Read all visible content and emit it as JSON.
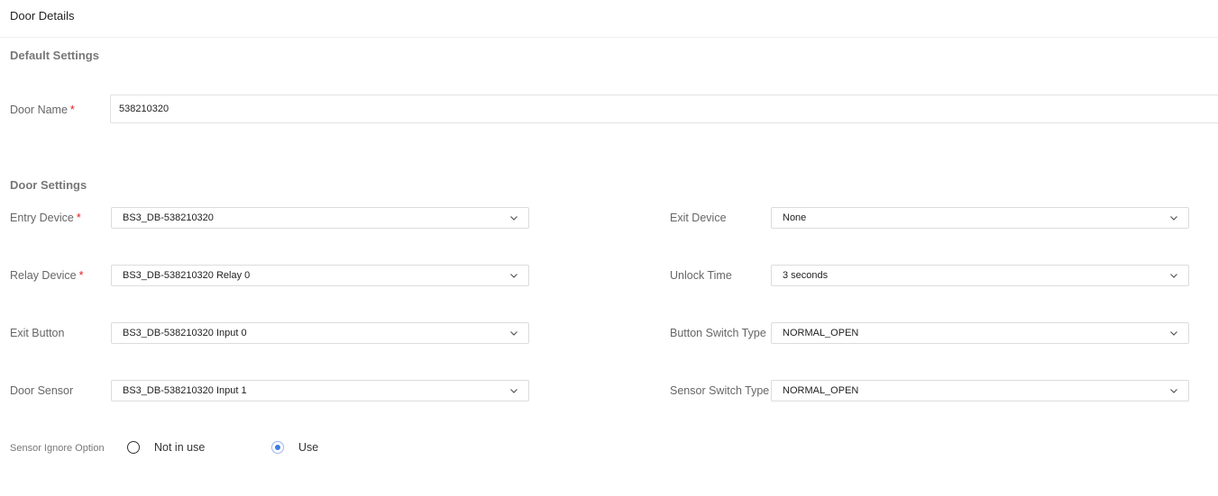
{
  "page": {
    "title": "Door Details"
  },
  "default_settings": {
    "section_title": "Default Settings",
    "door_name": {
      "label": "Door Name",
      "required_mark": "*",
      "value": "538210320"
    }
  },
  "door_settings": {
    "section_title": "Door Settings",
    "entry_device": {
      "label": "Entry Device",
      "required_mark": "*",
      "value": "BS3_DB-538210320"
    },
    "exit_device": {
      "label": "Exit Device",
      "value": "None"
    },
    "relay_device": {
      "label": "Relay Device",
      "required_mark": "*",
      "value": "BS3_DB-538210320 Relay 0"
    },
    "unlock_time": {
      "label": "Unlock Time",
      "value": "3 seconds"
    },
    "exit_button": {
      "label": "Exit Button",
      "value": "BS3_DB-538210320 Input 0"
    },
    "button_switch_type": {
      "label": "Button Switch Type",
      "value": "NORMAL_OPEN"
    },
    "door_sensor": {
      "label": "Door Sensor",
      "value": "BS3_DB-538210320 Input 1"
    },
    "sensor_switch_type": {
      "label": "Sensor Switch Type",
      "value": "NORMAL_OPEN"
    },
    "sensor_ignore_option": {
      "label": "Sensor Ignore Option",
      "options": [
        {
          "label": "Not in use",
          "selected": false
        },
        {
          "label": "Use",
          "selected": true
        }
      ]
    }
  },
  "icons": {
    "dropdown": "chevron-down-icon",
    "radio": "radio-button-icon"
  },
  "colors": {
    "required": "#e02020",
    "radio_selected": "#3d7be0",
    "border": "#dcdcdc"
  }
}
